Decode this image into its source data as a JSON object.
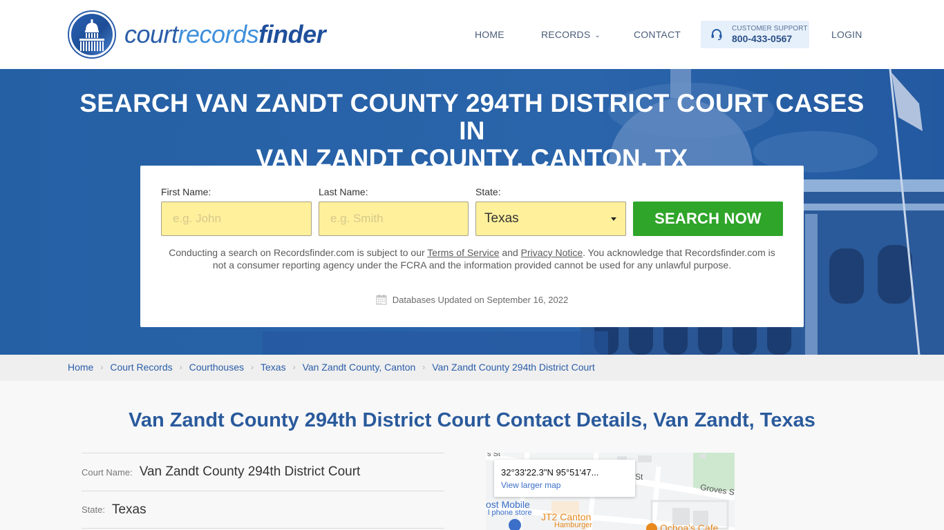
{
  "brand": {
    "name_part1": "court",
    "name_part2": "records",
    "name_part3": "finder"
  },
  "nav": {
    "items": [
      {
        "label": "HOME"
      },
      {
        "label": "RECORDS"
      },
      {
        "label": "CONTACT"
      },
      {
        "label": "LOGIN"
      }
    ],
    "records_chevron": "⌄",
    "support": {
      "label": "CUSTOMER SUPPORT",
      "phone": "800-433-0567",
      "icon": "headset-icon"
    }
  },
  "hero": {
    "title_line1": "SEARCH VAN ZANDT COUNTY 294TH DISTRICT COURT CASES IN",
    "title_line2": "VAN ZANDT COUNTY, CANTON, TX"
  },
  "search": {
    "first_name": {
      "label": "First Name:",
      "placeholder": "e.g. John",
      "value": ""
    },
    "last_name": {
      "label": "Last Name:",
      "placeholder": "e.g. Smith",
      "value": ""
    },
    "state": {
      "label": "State:",
      "value": "Texas"
    },
    "button_label": "SEARCH NOW",
    "disclaimer": {
      "part1": "Conducting a search on Recordsfinder.com is subject to our ",
      "terms_link": "Terms of Service",
      "part2": " and ",
      "privacy_link": "Privacy Notice",
      "part3": ". You acknowledge that Recordsfinder.com is not a consumer reporting agency under the FCRA and the information provided cannot be used for any unlawful purpose."
    },
    "db_updated": "Databases Updated on September 16, 2022",
    "db_icon": "calendar-icon"
  },
  "breadcrumb": [
    {
      "label": "Home"
    },
    {
      "label": "Court Records"
    },
    {
      "label": "Courthouses"
    },
    {
      "label": "Texas"
    },
    {
      "label": "Van Zandt County, Canton"
    },
    {
      "label": "Van Zandt County 294th District Court"
    }
  ],
  "breadcrumb_separator": "›",
  "main": {
    "title": "Van Zandt County 294th District Court Contact Details, Van Zandt, Texas",
    "details": [
      {
        "label": "Court Name:",
        "value": "Van Zandt County 294th District Court"
      },
      {
        "label": "State:",
        "value": "Texas"
      }
    ]
  },
  "map": {
    "coords": "32°33'22.3\"N 95°51'47...",
    "link": "View larger map",
    "labels": {
      "street_top_left": "s St",
      "street_mid": "St",
      "groves": "Groves St",
      "tmobile": "ost Mobile",
      "tmobile_sub": "l phone store",
      "jt2": "JT2 Canton",
      "jt2_sub": "Hamburger",
      "cafe": "Ochoa's Cafe"
    },
    "colors": {
      "business_orange": "#e8891d",
      "business_blue": "#3b6fc8",
      "park_green": "#cde8cf"
    }
  },
  "colors": {
    "brand_blue": "#2a5da8",
    "hero_blue": "#2560a5",
    "input_yellow": "#fff09c",
    "search_green": "#2fa52a",
    "support_bg": "#e6f0fb"
  }
}
